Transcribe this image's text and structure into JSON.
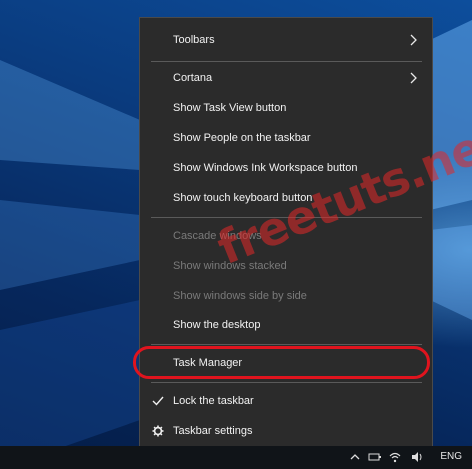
{
  "context_menu": {
    "toolbars": "Toolbars",
    "cortana": "Cortana",
    "show_task_view": "Show Task View button",
    "show_people": "Show People on the taskbar",
    "show_ink": "Show Windows Ink Workspace button",
    "show_touch_keyboard": "Show touch keyboard button",
    "cascade": "Cascade windows",
    "stacked": "Show windows stacked",
    "side_by_side": "Show windows side by side",
    "show_desktop": "Show the desktop",
    "task_manager": "Task Manager",
    "lock_taskbar": "Lock the taskbar",
    "taskbar_settings": "Taskbar settings"
  },
  "watermark": "freetuts.net",
  "taskbar": {
    "language": "ENG"
  },
  "colors": {
    "highlight_ring": "#e0141e",
    "menu_bg": "#2b2b2b"
  }
}
